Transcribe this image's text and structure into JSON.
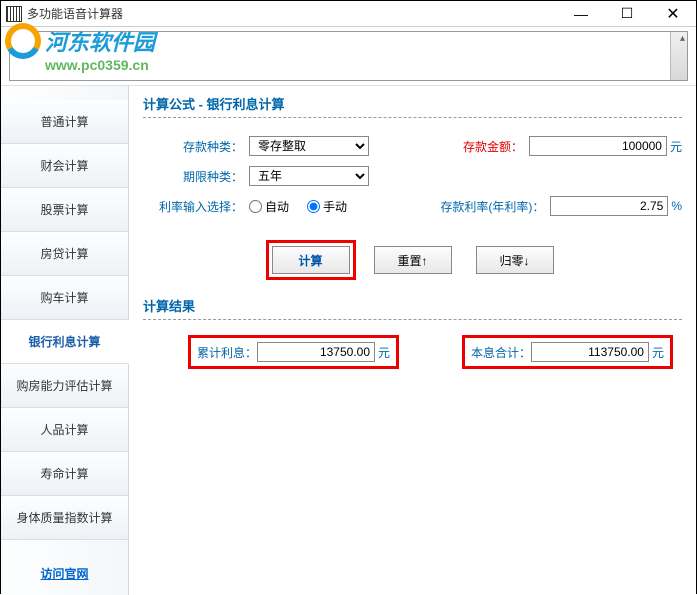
{
  "window": {
    "title": "多功能语音计算器",
    "min": "—",
    "max": "☐",
    "close": "✕"
  },
  "watermark": {
    "brand": "河东软件园",
    "url": "www.pc0359.cn"
  },
  "sidebar": {
    "items": [
      {
        "label": "普通计算"
      },
      {
        "label": "财会计算"
      },
      {
        "label": "股票计算"
      },
      {
        "label": "房贷计算"
      },
      {
        "label": "购车计算"
      },
      {
        "label": "银行利息计算"
      },
      {
        "label": "购房能力评估计算"
      },
      {
        "label": "人品计算"
      },
      {
        "label": "寿命计算"
      },
      {
        "label": "身体质量指数计算"
      }
    ],
    "footer": "访问官网"
  },
  "content": {
    "title": "计算公式 - 银行利息计算",
    "deposit_type_label": "存款种类：",
    "deposit_type_value": "零存整取",
    "period_label": "期限种类：",
    "period_value": "五年",
    "rate_mode_label": "利率输入选择：",
    "rate_mode_auto": "自动",
    "rate_mode_manual": "手动",
    "amount_label": "存款金额：",
    "amount_value": "100000",
    "amount_suffix": "元",
    "rate_label": "存款利率(年利率)：",
    "rate_value": "2.75",
    "rate_suffix": "%",
    "buttons": {
      "calc": "计算",
      "reset": "重置↑",
      "zero": "归零↓"
    },
    "result_title": "计算结果",
    "interest_label": "累计利息：",
    "interest_value": "13750.00",
    "total_label": "本息合计：",
    "total_value": "113750.00",
    "yuan": "元"
  }
}
